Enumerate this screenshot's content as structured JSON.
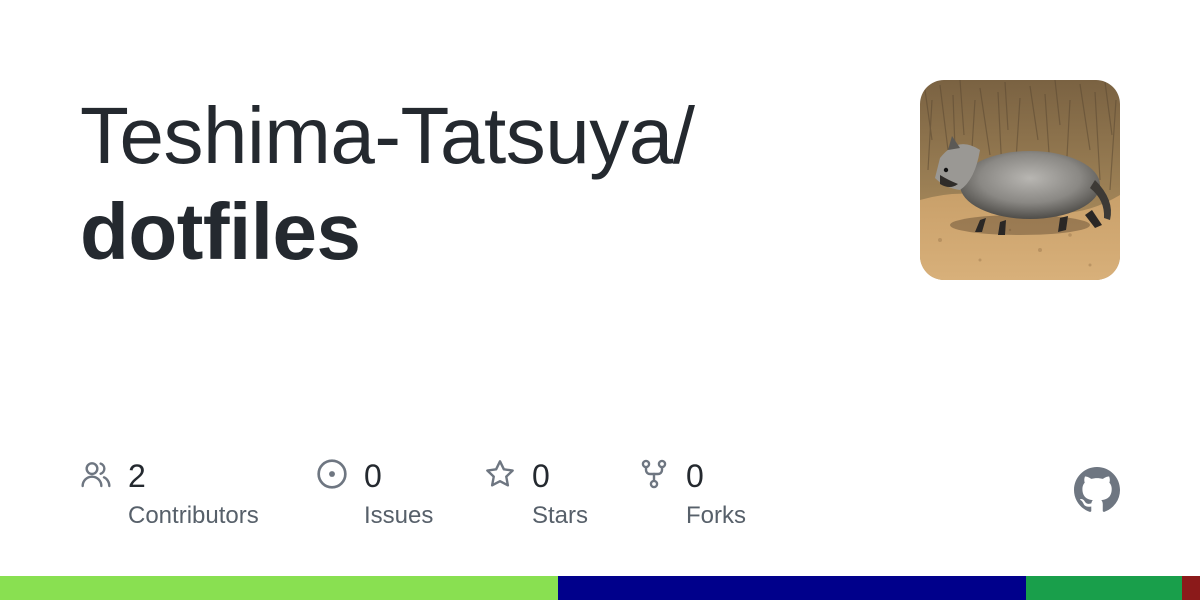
{
  "repo": {
    "owner": "Teshima-Tatsuya/",
    "name": "dotfiles"
  },
  "stats": [
    {
      "icon": "people-icon",
      "value": "2",
      "label": "Contributors"
    },
    {
      "icon": "issue-opened-icon",
      "value": "0",
      "label": "Issues"
    },
    {
      "icon": "star-icon",
      "value": "0",
      "label": "Stars"
    },
    {
      "icon": "repo-forked-icon",
      "value": "0",
      "label": "Forks"
    }
  ],
  "avatar": {
    "icon": "owner-avatar-raccoon-dog-photo"
  },
  "brand": {
    "icon": "github-mark-icon",
    "color": "#6e7681"
  },
  "colors": {
    "text": "#24292f",
    "muted": "#57606a",
    "icon": "#6e7681"
  },
  "languages": [
    {
      "color": "#89e051",
      "fraction": 0.465
    },
    {
      "color": "#00008b",
      "fraction": 0.39
    },
    {
      "color": "#199f4b",
      "fraction": 0.13
    },
    {
      "color": "#8b1a1a",
      "fraction": 0.015
    }
  ]
}
